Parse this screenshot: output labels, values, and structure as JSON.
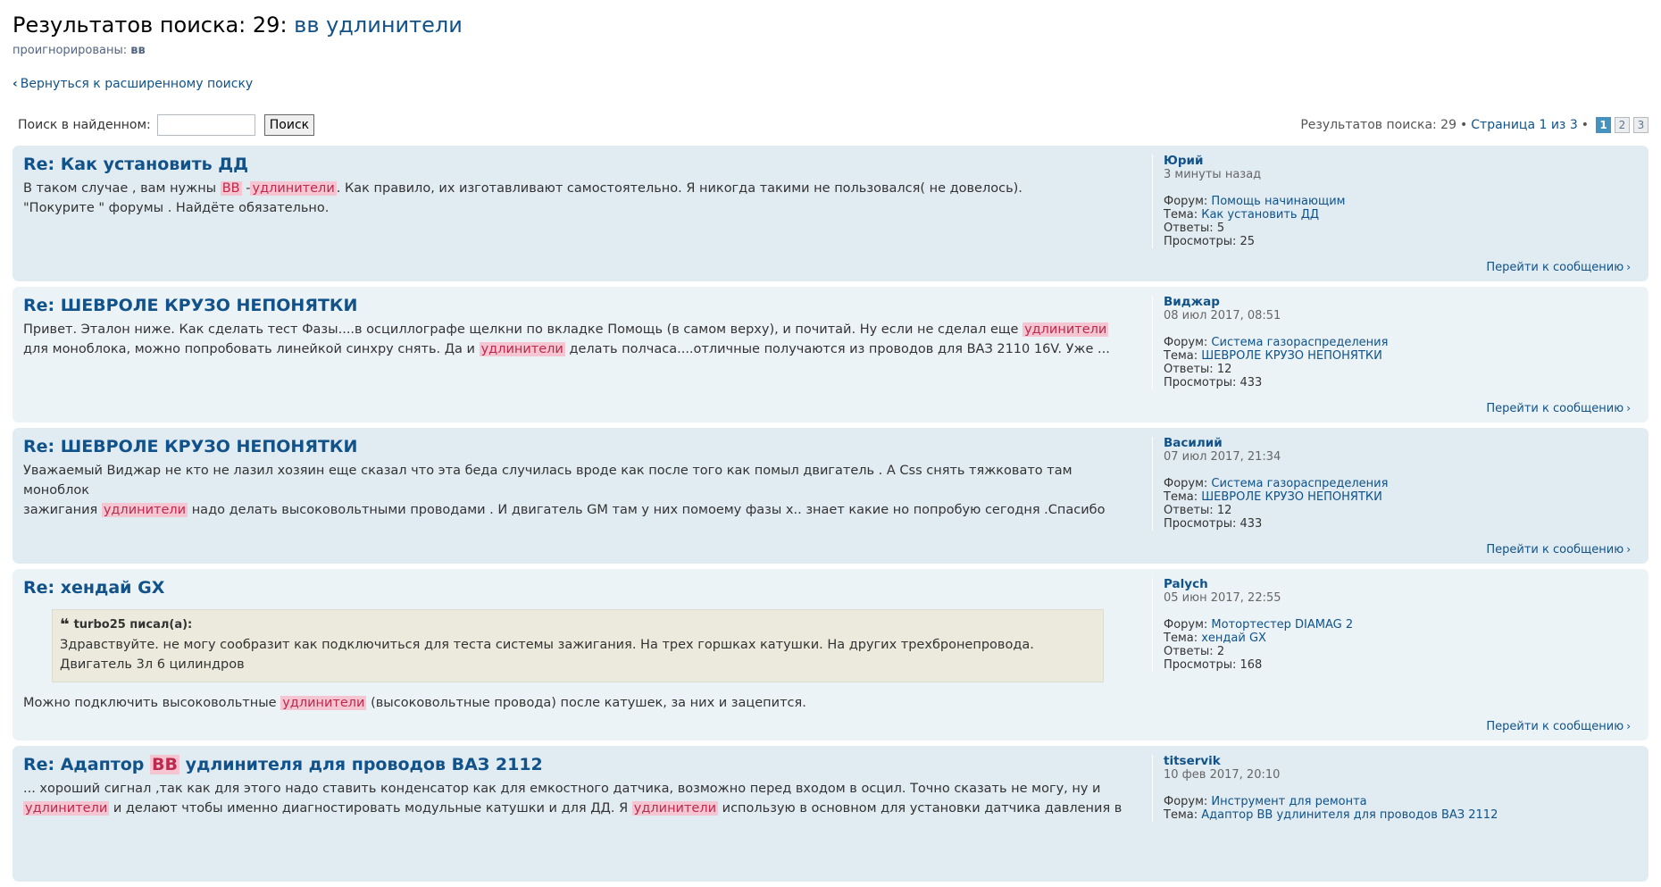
{
  "page": {
    "title_prefix": "Результатов поиска: 29:",
    "query": "вв удлинители",
    "ignored_label": "проигнорированы:",
    "ignored_word": "вв",
    "back_link": "Вернуться к расширенному поиску",
    "search_within_label": "Поиск в найденном:",
    "search_within_value": "",
    "search_button": "Поиск"
  },
  "pagination": {
    "results_text": "Результатов поиска: 29",
    "page_text": "Страница 1 из 3",
    "pages": [
      "1",
      "2",
      "3"
    ],
    "current": "1"
  },
  "meta_labels": {
    "forum": "Форум:",
    "topic": "Тема:",
    "replies": "Ответы:",
    "views": "Просмотры:",
    "jump": "Перейти к сообщению"
  },
  "posts": [
    {
      "title": "Re: Как установить ДД",
      "author": "Юрий",
      "time": "3 минуты назад",
      "forum": "Помощь начинающим",
      "topic": "Как установить ДД",
      "replies": "5",
      "views": "25",
      "c": {
        "t1": "В таком случае , вам нужны ",
        "h1": "ВВ",
        "t2": " -",
        "h2": "удлинители",
        "t3": ". Как правило, их изготавливают самостоятельно. Я никогда такими не пользовался( не довелось).",
        "t4": "\"Покурите \" форумы . Найдёте обязательно."
      }
    },
    {
      "title": "Re: ШЕВРОЛЕ КРУЗО НЕПОНЯТКИ",
      "author": "Виджар",
      "time": "08 июл 2017, 08:51",
      "forum": "Система газораспределения",
      "topic": "ШЕВРОЛЕ КРУЗО НЕПОНЯТКИ",
      "replies": "12",
      "views": "433",
      "c": {
        "t1": "Привет. Эталон ниже. Как сделать тест Фазы....в осциллографе щелкни по вкладке Помощь (в самом верху), и почитай. Ну если не сделал еще ",
        "h1": "удлинители",
        "t2": "для моноблока, можно попробовать линейкой синхру снять. Да и ",
        "h2": "удлинители",
        "t3": " делать полчаса....отличные получаются из проводов для ВАЗ 2110 16V. Уже ..."
      }
    },
    {
      "title": "Re: ШЕВРОЛЕ КРУЗО НЕПОНЯТКИ",
      "author": "Василий",
      "time": "07 июл 2017, 21:34",
      "forum": "Система газораспределения",
      "topic": "ШЕВРОЛЕ КРУЗО НЕПОНЯТКИ",
      "replies": "12",
      "views": "433",
      "c": {
        "t1": "Уважаемый Виджар не кто не лазил хозяин еще сказал что эта беда случилась вроде как после того как помыл двигатель . А Css снять тяжковато там моноблок",
        "t2": "зажигания ",
        "h1": "удлинители",
        "t3": " надо делать высоковольтными проводами . И двигатель GM там у них помоему фазы х.. знает какие но попробую сегодня .Спасибо"
      }
    },
    {
      "title": "Re: хендай GX",
      "author": "Palych",
      "time": "05 июн 2017, 22:55",
      "forum": "Мотортестер DIAMAG 2",
      "topic": "хендай GX",
      "replies": "2",
      "views": "168",
      "quote": {
        "author": "turbo25 писал(а):",
        "text": "Здравствуйте. не могу сообразит как подключиться для теста системы зажигания. На трех горшках катушки. На других трехбронепровода. Двигатель 3л 6 цилиндров"
      },
      "c": {
        "t1": "Можно подключить высоковольтные ",
        "h1": "удлинители",
        "t2": " (высоковольтные провода) после катушек, за них и зацепится."
      }
    },
    {
      "title_pre": "Re: Адаптор ",
      "title_hl": "ВВ",
      "title_post": " удлинителя для проводов ВАЗ 2112",
      "author": "titservik",
      "time": "10 фев 2017, 20:10",
      "forum": "Инструмент для ремонта",
      "topic": "Адаптор ВВ удлинителя для проводов ВАЗ 2112",
      "c": {
        "t1": "... хороший сигнал ,так как для этого надо ставить конденсатор как для емкостного датчика, возможно перед входом в осцил. Точно сказать не могу, ну и",
        "h1": "удлинители",
        "t2": " и делают чтобы именно диагностировать модульные катушки и для ДД. Я ",
        "h2": "удлинители",
        "t3": " использую в основном для установки датчика давления в"
      }
    }
  ]
}
